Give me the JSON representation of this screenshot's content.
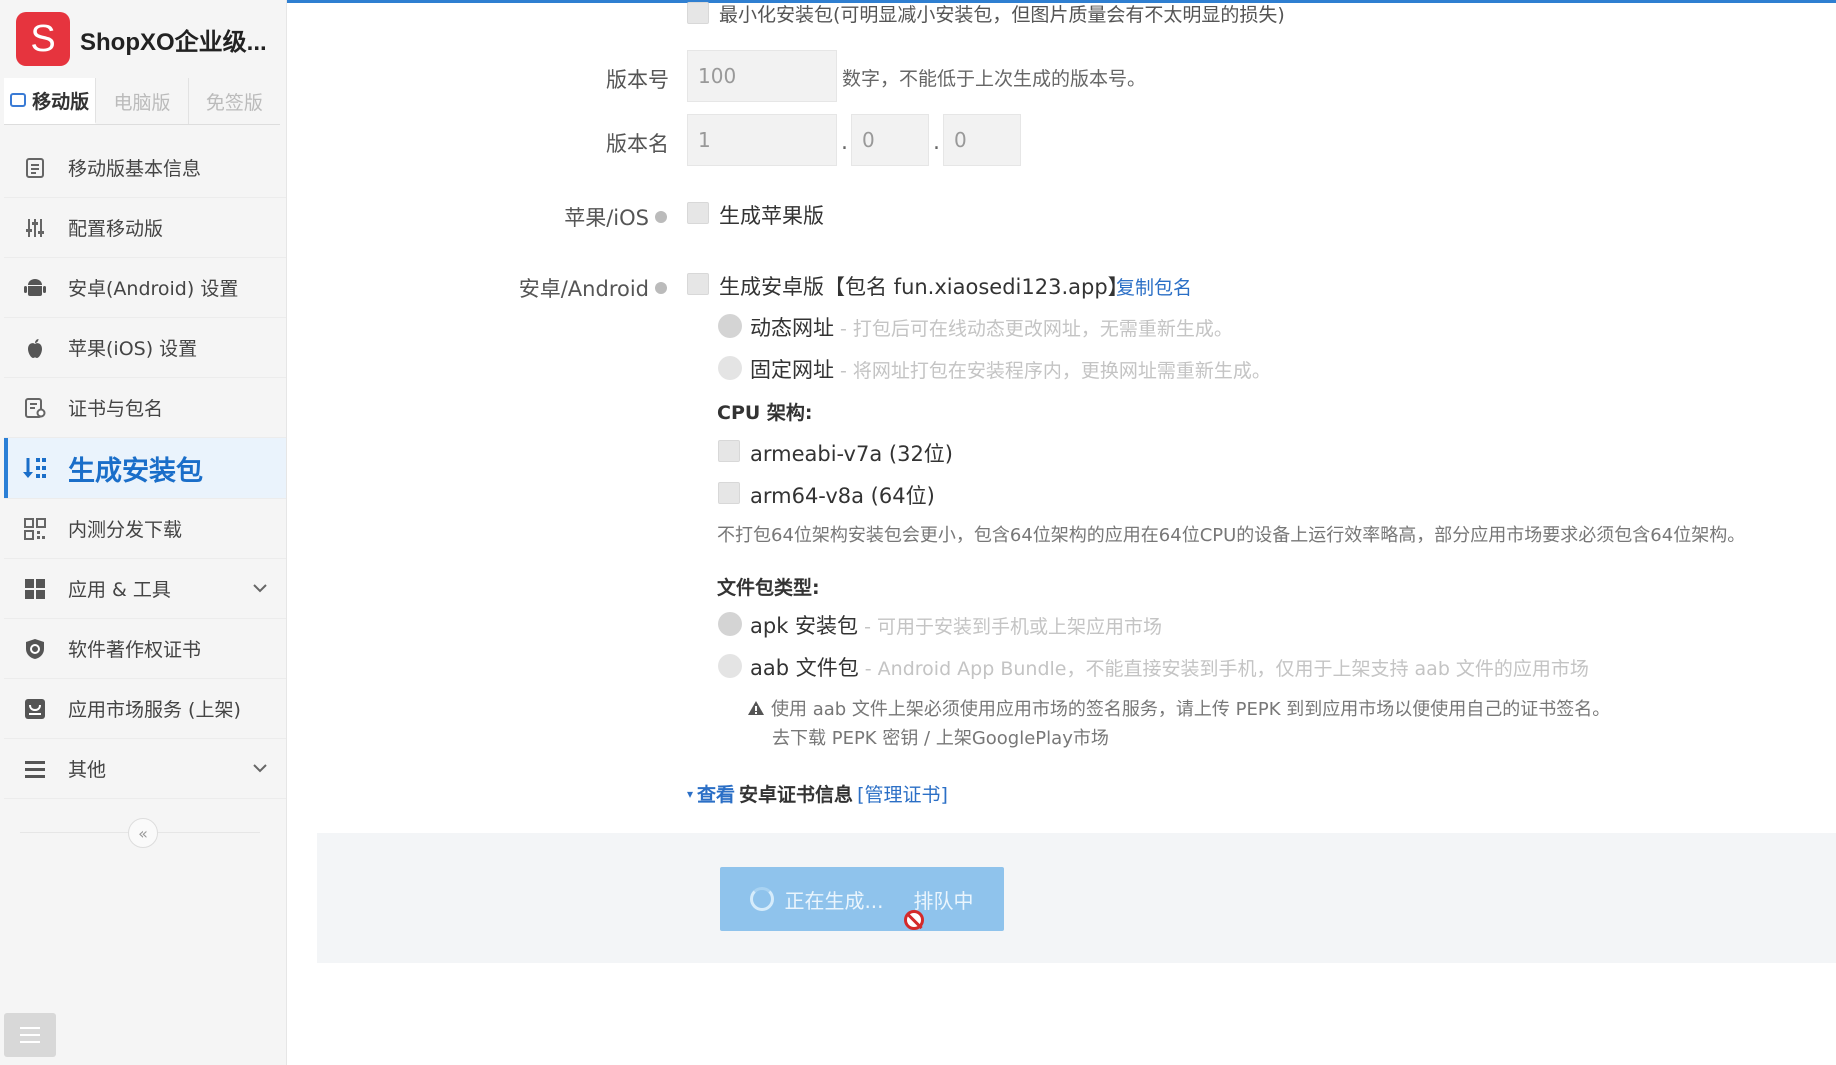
{
  "brand": {
    "logo_letter": "S",
    "name": "ShopXO企业级..."
  },
  "platform_tabs": [
    {
      "label": "移动版",
      "active": true
    },
    {
      "label": "电脑版",
      "active": false
    },
    {
      "label": "免签版",
      "active": false
    }
  ],
  "nav": [
    {
      "label": "移动版基本信息",
      "icon": "document-icon"
    },
    {
      "label": "配置移动版",
      "icon": "sliders-icon"
    },
    {
      "label": "安卓(Android) 设置",
      "icon": "android-icon"
    },
    {
      "label": "苹果(iOS) 设置",
      "icon": "apple-icon"
    },
    {
      "label": "证书与包名",
      "icon": "certificate-icon"
    },
    {
      "label": "生成安装包",
      "icon": "sort-download-icon",
      "active": true
    },
    {
      "label": "内测分发下载",
      "icon": "qrcode-icon"
    },
    {
      "label": "应用 & 工具",
      "icon": "grid-icon",
      "expandable": true
    },
    {
      "label": "软件著作权证书",
      "icon": "shield-icon"
    },
    {
      "label": "应用市场服务 (上架)",
      "icon": "store-icon"
    },
    {
      "label": "其他",
      "icon": "list-icon",
      "expandable": true
    }
  ],
  "form": {
    "top_option": "最小化安装包(可明显减小安装包，但图片质量会有不太明显的损失)",
    "version_code": {
      "label": "版本号",
      "value": "100",
      "hint": "数字，不能低于上次生成的版本号。"
    },
    "version_name": {
      "label": "版本名",
      "major": "1",
      "minor": "0",
      "patch": "0",
      "sep": "."
    },
    "ios": {
      "label": "苹果/iOS",
      "checkbox": "生成苹果版"
    },
    "android": {
      "label": "安卓/Android",
      "checkbox": "生成安卓版【包名 fun.xiaosedi123.app】",
      "copy_link": "复制包名",
      "url_options": [
        {
          "label": "动态网址",
          "desc": " - 打包后可在线动态更改网址，无需重新生成。",
          "selected": true
        },
        {
          "label": "固定网址",
          "desc": " - 将网址打包在安装程序内，更换网址需重新生成。",
          "selected": false
        }
      ],
      "cpu_title": "CPU 架构:",
      "cpu_options": [
        "armeabi-v7a (32位)",
        "arm64-v8a (64位)"
      ],
      "cpu_note": "不打包64位架构安装包会更小，包含64位架构的应用在64位CPU的设备上运行效率略高，部分应用市场要求必须包含64位架构。",
      "file_title": "文件包类型:",
      "file_options": [
        {
          "label": "apk 安装包",
          "desc": " - 可用于安装到手机或上架应用市场",
          "selected": true
        },
        {
          "label": "aab 文件包",
          "desc": " - Android App Bundle，不能直接安装到手机，仅用于上架支持 aab 文件的应用市场",
          "selected": false
        }
      ],
      "aab_warning": "使用 aab 文件上架必须使用应用市场的签名服务，请上传 PEPK 到到应用市场以便使用自己的证书签名。",
      "aab_links": "去下载 PEPK 密钥 / 上架GooglePlay市场",
      "cert_view": "查看",
      "cert_label": "安卓证书信息",
      "cert_manage": "[管理证书]"
    }
  },
  "generate_button": {
    "label": "正在生成...",
    "queue": "排队中"
  },
  "colors": {
    "accent": "#2b7fd6",
    "brand": "#e6343e",
    "button": "#8fc3ec"
  }
}
